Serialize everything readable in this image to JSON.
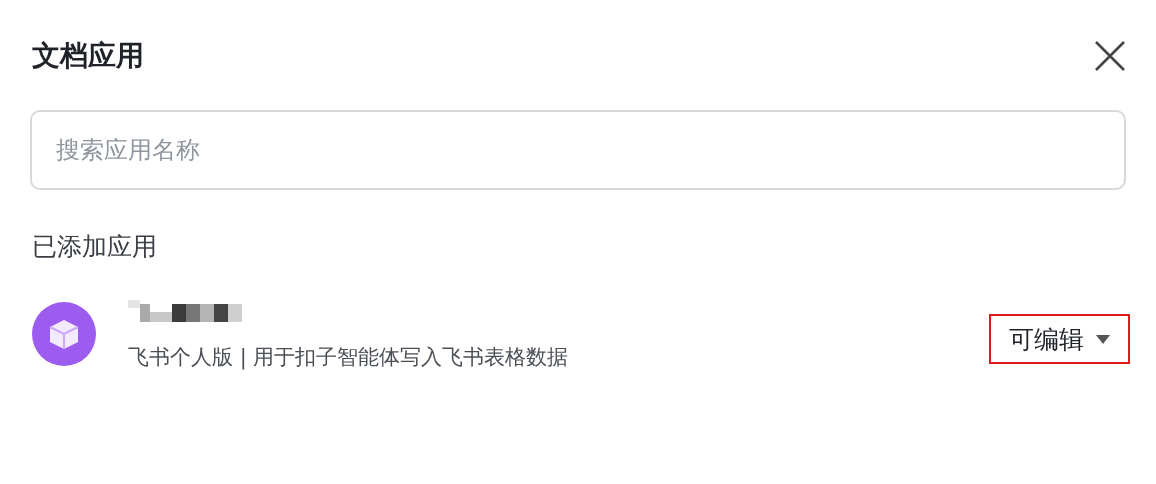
{
  "dialog": {
    "title": "文档应用"
  },
  "search": {
    "placeholder": "搜索应用名称"
  },
  "section_title": "已添加应用",
  "apps": [
    {
      "description": "飞书个人版 | 用于扣子智能体写入飞书表格数据",
      "permission": "可编辑",
      "highlighted": true
    }
  ]
}
